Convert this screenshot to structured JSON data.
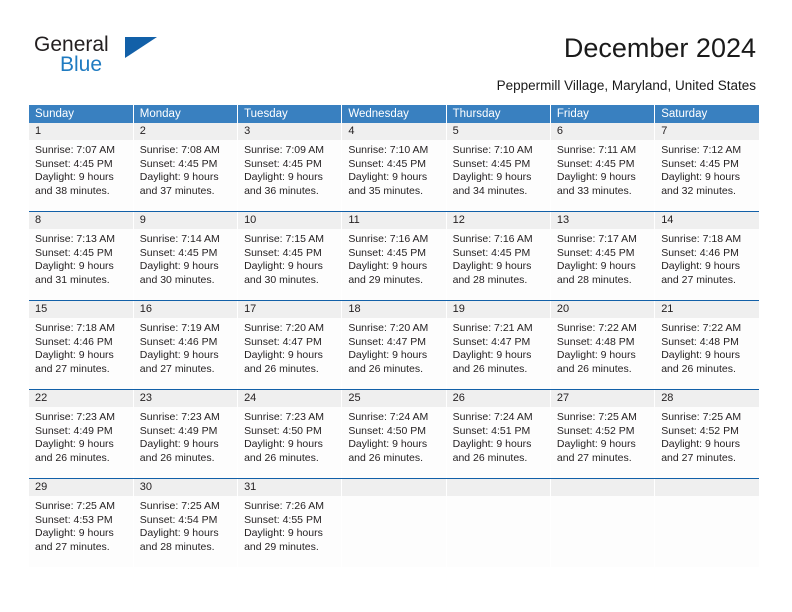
{
  "brand": {
    "name_top": "General",
    "name_bottom": "Blue",
    "triangle_color": "#1260a8",
    "blue_color": "#1f7bc1"
  },
  "header": {
    "title": "December 2024",
    "subtitle": "Peppermill Village, Maryland, United States"
  },
  "theme": {
    "header_blue": "#3980c0",
    "divider_blue": "#1260a8",
    "daynum_band": "#efefef"
  },
  "weekdays": [
    "Sunday",
    "Monday",
    "Tuesday",
    "Wednesday",
    "Thursday",
    "Friday",
    "Saturday"
  ],
  "weeks": [
    [
      {
        "day": "1",
        "sunrise": "Sunrise: 7:07 AM",
        "sunset": "Sunset: 4:45 PM",
        "daylight1": "Daylight: 9 hours",
        "daylight2": "and 38 minutes."
      },
      {
        "day": "2",
        "sunrise": "Sunrise: 7:08 AM",
        "sunset": "Sunset: 4:45 PM",
        "daylight1": "Daylight: 9 hours",
        "daylight2": "and 37 minutes."
      },
      {
        "day": "3",
        "sunrise": "Sunrise: 7:09 AM",
        "sunset": "Sunset: 4:45 PM",
        "daylight1": "Daylight: 9 hours",
        "daylight2": "and 36 minutes."
      },
      {
        "day": "4",
        "sunrise": "Sunrise: 7:10 AM",
        "sunset": "Sunset: 4:45 PM",
        "daylight1": "Daylight: 9 hours",
        "daylight2": "and 35 minutes."
      },
      {
        "day": "5",
        "sunrise": "Sunrise: 7:10 AM",
        "sunset": "Sunset: 4:45 PM",
        "daylight1": "Daylight: 9 hours",
        "daylight2": "and 34 minutes."
      },
      {
        "day": "6",
        "sunrise": "Sunrise: 7:11 AM",
        "sunset": "Sunset: 4:45 PM",
        "daylight1": "Daylight: 9 hours",
        "daylight2": "and 33 minutes."
      },
      {
        "day": "7",
        "sunrise": "Sunrise: 7:12 AM",
        "sunset": "Sunset: 4:45 PM",
        "daylight1": "Daylight: 9 hours",
        "daylight2": "and 32 minutes."
      }
    ],
    [
      {
        "day": "8",
        "sunrise": "Sunrise: 7:13 AM",
        "sunset": "Sunset: 4:45 PM",
        "daylight1": "Daylight: 9 hours",
        "daylight2": "and 31 minutes."
      },
      {
        "day": "9",
        "sunrise": "Sunrise: 7:14 AM",
        "sunset": "Sunset: 4:45 PM",
        "daylight1": "Daylight: 9 hours",
        "daylight2": "and 30 minutes."
      },
      {
        "day": "10",
        "sunrise": "Sunrise: 7:15 AM",
        "sunset": "Sunset: 4:45 PM",
        "daylight1": "Daylight: 9 hours",
        "daylight2": "and 30 minutes."
      },
      {
        "day": "11",
        "sunrise": "Sunrise: 7:16 AM",
        "sunset": "Sunset: 4:45 PM",
        "daylight1": "Daylight: 9 hours",
        "daylight2": "and 29 minutes."
      },
      {
        "day": "12",
        "sunrise": "Sunrise: 7:16 AM",
        "sunset": "Sunset: 4:45 PM",
        "daylight1": "Daylight: 9 hours",
        "daylight2": "and 28 minutes."
      },
      {
        "day": "13",
        "sunrise": "Sunrise: 7:17 AM",
        "sunset": "Sunset: 4:45 PM",
        "daylight1": "Daylight: 9 hours",
        "daylight2": "and 28 minutes."
      },
      {
        "day": "14",
        "sunrise": "Sunrise: 7:18 AM",
        "sunset": "Sunset: 4:46 PM",
        "daylight1": "Daylight: 9 hours",
        "daylight2": "and 27 minutes."
      }
    ],
    [
      {
        "day": "15",
        "sunrise": "Sunrise: 7:18 AM",
        "sunset": "Sunset: 4:46 PM",
        "daylight1": "Daylight: 9 hours",
        "daylight2": "and 27 minutes."
      },
      {
        "day": "16",
        "sunrise": "Sunrise: 7:19 AM",
        "sunset": "Sunset: 4:46 PM",
        "daylight1": "Daylight: 9 hours",
        "daylight2": "and 27 minutes."
      },
      {
        "day": "17",
        "sunrise": "Sunrise: 7:20 AM",
        "sunset": "Sunset: 4:47 PM",
        "daylight1": "Daylight: 9 hours",
        "daylight2": "and 26 minutes."
      },
      {
        "day": "18",
        "sunrise": "Sunrise: 7:20 AM",
        "sunset": "Sunset: 4:47 PM",
        "daylight1": "Daylight: 9 hours",
        "daylight2": "and 26 minutes."
      },
      {
        "day": "19",
        "sunrise": "Sunrise: 7:21 AM",
        "sunset": "Sunset: 4:47 PM",
        "daylight1": "Daylight: 9 hours",
        "daylight2": "and 26 minutes."
      },
      {
        "day": "20",
        "sunrise": "Sunrise: 7:22 AM",
        "sunset": "Sunset: 4:48 PM",
        "daylight1": "Daylight: 9 hours",
        "daylight2": "and 26 minutes."
      },
      {
        "day": "21",
        "sunrise": "Sunrise: 7:22 AM",
        "sunset": "Sunset: 4:48 PM",
        "daylight1": "Daylight: 9 hours",
        "daylight2": "and 26 minutes."
      }
    ],
    [
      {
        "day": "22",
        "sunrise": "Sunrise: 7:23 AM",
        "sunset": "Sunset: 4:49 PM",
        "daylight1": "Daylight: 9 hours",
        "daylight2": "and 26 minutes."
      },
      {
        "day": "23",
        "sunrise": "Sunrise: 7:23 AM",
        "sunset": "Sunset: 4:49 PM",
        "daylight1": "Daylight: 9 hours",
        "daylight2": "and 26 minutes."
      },
      {
        "day": "24",
        "sunrise": "Sunrise: 7:23 AM",
        "sunset": "Sunset: 4:50 PM",
        "daylight1": "Daylight: 9 hours",
        "daylight2": "and 26 minutes."
      },
      {
        "day": "25",
        "sunrise": "Sunrise: 7:24 AM",
        "sunset": "Sunset: 4:50 PM",
        "daylight1": "Daylight: 9 hours",
        "daylight2": "and 26 minutes."
      },
      {
        "day": "26",
        "sunrise": "Sunrise: 7:24 AM",
        "sunset": "Sunset: 4:51 PM",
        "daylight1": "Daylight: 9 hours",
        "daylight2": "and 26 minutes."
      },
      {
        "day": "27",
        "sunrise": "Sunrise: 7:25 AM",
        "sunset": "Sunset: 4:52 PM",
        "daylight1": "Daylight: 9 hours",
        "daylight2": "and 27 minutes."
      },
      {
        "day": "28",
        "sunrise": "Sunrise: 7:25 AM",
        "sunset": "Sunset: 4:52 PM",
        "daylight1": "Daylight: 9 hours",
        "daylight2": "and 27 minutes."
      }
    ],
    [
      {
        "day": "29",
        "sunrise": "Sunrise: 7:25 AM",
        "sunset": "Sunset: 4:53 PM",
        "daylight1": "Daylight: 9 hours",
        "daylight2": "and 27 minutes."
      },
      {
        "day": "30",
        "sunrise": "Sunrise: 7:25 AM",
        "sunset": "Sunset: 4:54 PM",
        "daylight1": "Daylight: 9 hours",
        "daylight2": "and 28 minutes."
      },
      {
        "day": "31",
        "sunrise": "Sunrise: 7:26 AM",
        "sunset": "Sunset: 4:55 PM",
        "daylight1": "Daylight: 9 hours",
        "daylight2": "and 29 minutes."
      },
      {
        "day": "",
        "sunrise": "",
        "sunset": "",
        "daylight1": "",
        "daylight2": ""
      },
      {
        "day": "",
        "sunrise": "",
        "sunset": "",
        "daylight1": "",
        "daylight2": ""
      },
      {
        "day": "",
        "sunrise": "",
        "sunset": "",
        "daylight1": "",
        "daylight2": ""
      },
      {
        "day": "",
        "sunrise": "",
        "sunset": "",
        "daylight1": "",
        "daylight2": ""
      }
    ]
  ]
}
